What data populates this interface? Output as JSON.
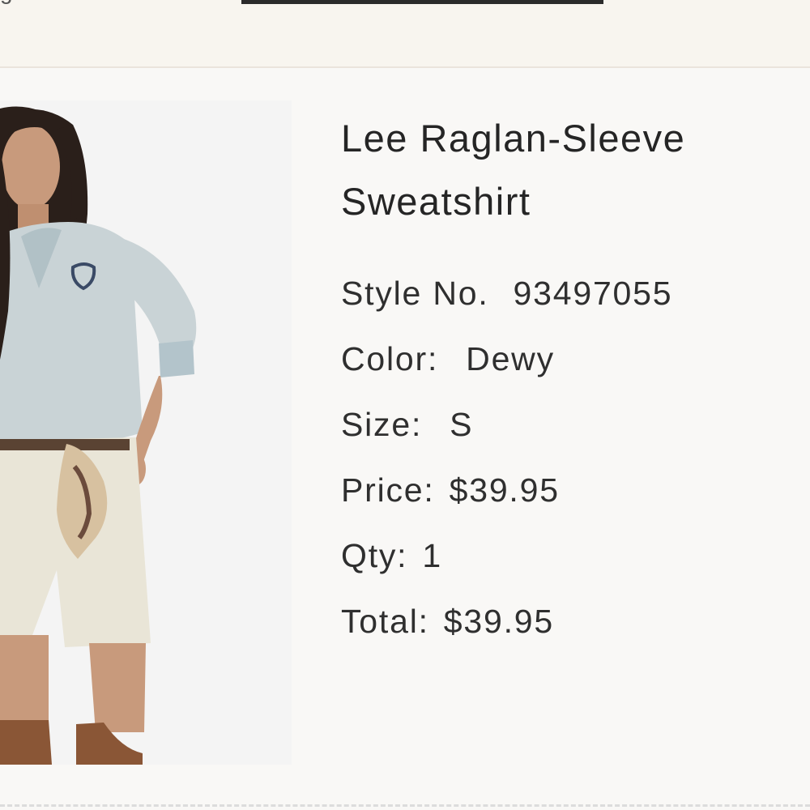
{
  "header": {
    "partial_text": "g"
  },
  "product": {
    "title_line1": "Lee Raglan-Sleeve",
    "title_line2": "Sweatshirt",
    "details": {
      "style_label": "Style No.",
      "style_value": "93497055",
      "color_label": "Color:",
      "color_value": "Dewy",
      "size_label": "Size:",
      "size_value": "S",
      "price_label": "Price:",
      "price_value": "$39.95",
      "qty_label": "Qty:",
      "qty_value": "1",
      "total_label": "Total:",
      "total_value": "$39.95"
    },
    "image_icon": "product-photo-model-sweatshirt"
  },
  "colors": {
    "page_background": "#f9f8f6",
    "header_background": "#f8f5ef",
    "text": "#2a2a2a",
    "sweatshirt": "#c9d3d6"
  }
}
